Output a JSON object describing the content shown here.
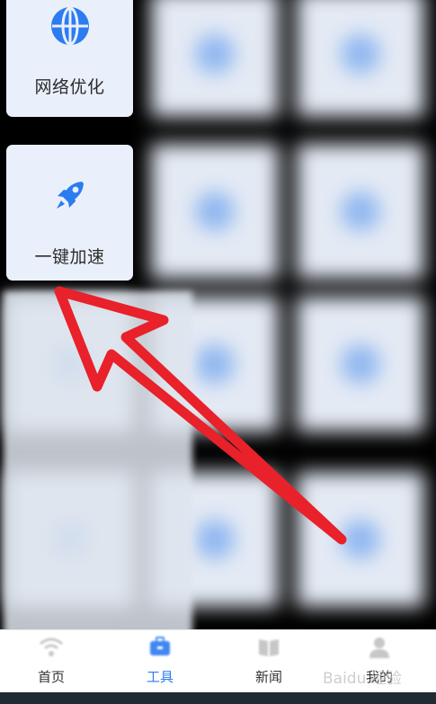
{
  "tools": [
    {
      "label": "网络优化",
      "icon": "globe-icon"
    },
    {
      "label": "一键加速",
      "icon": "rocket-icon"
    }
  ],
  "tabbar": {
    "tabs": [
      {
        "label": "首页",
        "icon": "wifi-icon",
        "active": false
      },
      {
        "label": "工具",
        "icon": "toolbox-icon",
        "active": true
      },
      {
        "label": "新闻",
        "icon": "newspaper-icon",
        "active": false
      },
      {
        "label": "我的",
        "icon": "user-icon",
        "active": false
      }
    ]
  },
  "colors": {
    "accent": "#2c7cf0",
    "tile_bg": "#eaf0fb",
    "annotation_arrow": "#e8212a"
  },
  "watermark": "Baidu 经验"
}
